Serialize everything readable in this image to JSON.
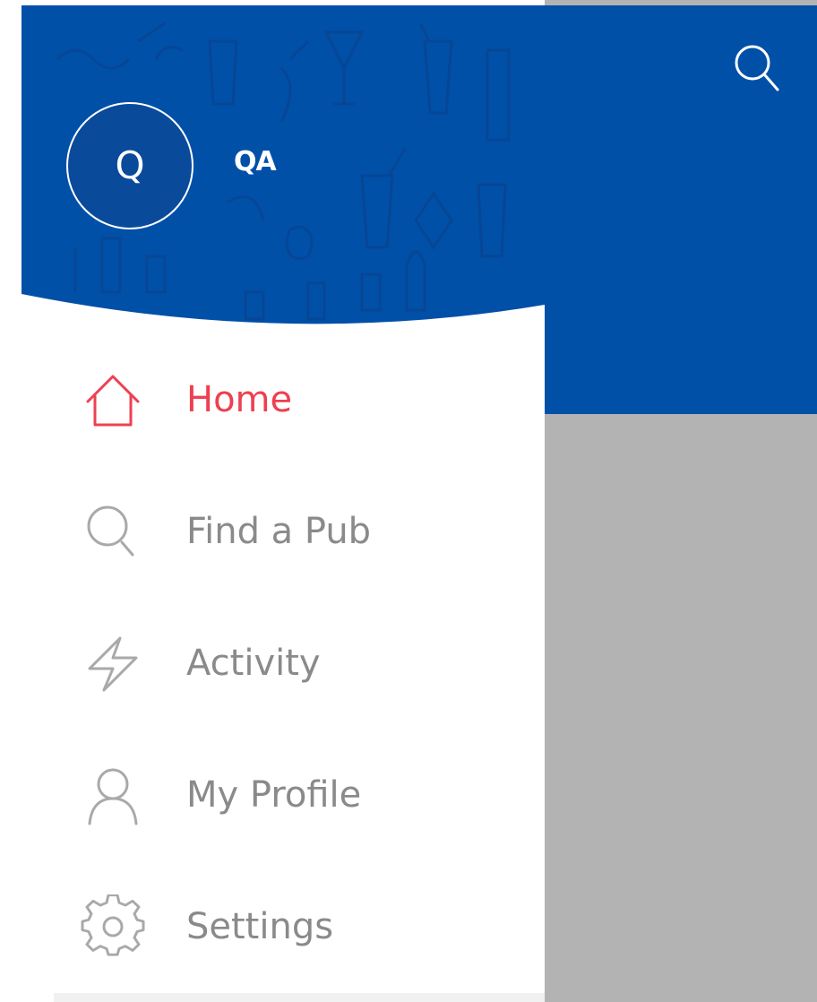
{
  "user": {
    "initial": "Q",
    "name": "QA"
  },
  "menu": {
    "items": [
      {
        "label": "Home",
        "icon": "home-icon",
        "active": true
      },
      {
        "label": "Find a Pub",
        "icon": "search-icon",
        "active": false
      },
      {
        "label": "Activity",
        "icon": "lightning-icon",
        "active": false
      },
      {
        "label": "My Profile",
        "icon": "profile-icon",
        "active": false
      },
      {
        "label": "Settings",
        "icon": "gear-icon",
        "active": false
      }
    ]
  },
  "colors": {
    "brand_blue": "#0050a8",
    "active_red": "#ee4050",
    "inactive_gray": "#8a8a8a",
    "overlay_gray": "#b3b3b3"
  }
}
